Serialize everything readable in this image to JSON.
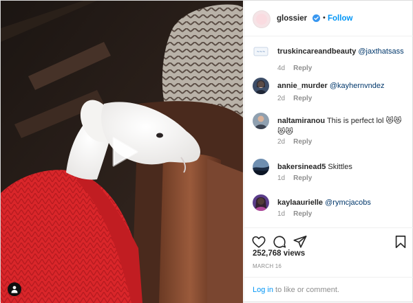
{
  "post": {
    "username": "glossier",
    "separator": "•",
    "follow_label": "Follow",
    "views": "252,768 views",
    "date": "MARCH 16"
  },
  "icons": {
    "verified": "verified-badge-icon",
    "play": "play-icon",
    "tag": "user-tag-icon",
    "like": "heart-icon",
    "comment": "comment-icon",
    "share": "share-icon",
    "save": "bookmark-icon"
  },
  "colors": {
    "accent": "#0095f6",
    "mention": "#00376b",
    "muted": "#8e8e8e"
  },
  "comments": [
    {
      "user": "truskincareandbeauty",
      "text": "",
      "mention": "@jaxthatsass",
      "age": "4d",
      "reply": "Reply"
    },
    {
      "user": "annie_murder",
      "text": "",
      "mention": "@kayhernvndez",
      "age": "2d",
      "reply": "Reply"
    },
    {
      "user": "naltamiranou",
      "text": "This is perfect lol",
      "emoji": "😻😻😻😻",
      "mention": "",
      "age": "2d",
      "reply": "Reply"
    },
    {
      "user": "bakersinead5",
      "text": "Skittles",
      "mention": "",
      "age": "1d",
      "reply": "Reply"
    },
    {
      "user": "kaylaaurielle",
      "text": "",
      "mention": "@rymcjacobs",
      "age": "1d",
      "reply": "Reply"
    }
  ],
  "login": {
    "link": "Log in",
    "rest": " to like or comment."
  }
}
